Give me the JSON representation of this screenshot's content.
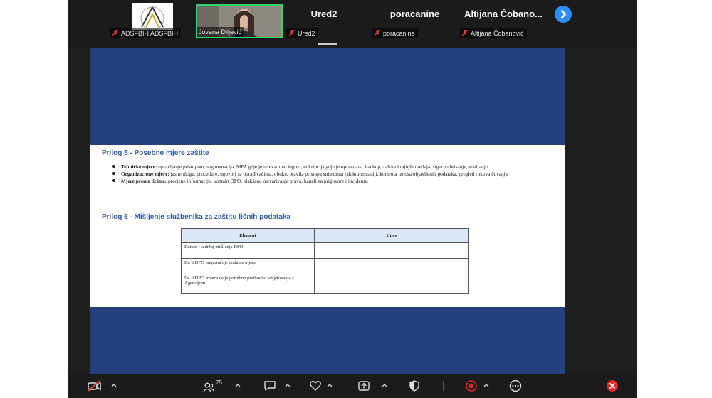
{
  "participants": [
    {
      "label": "ADSFBIH ADSFBIH",
      "kind": "avatar"
    },
    {
      "label": "Jovana Diljević",
      "kind": "video"
    },
    {
      "label": "Ured2",
      "display_name": "Ured2",
      "kind": "name"
    },
    {
      "label": "poracanine",
      "display_name": "poracanine",
      "kind": "name"
    },
    {
      "label": "Altijana Čobanović",
      "display_name": "Altijana Čobano...",
      "kind": "name"
    }
  ],
  "document": {
    "section5_title": "Prilog 5 - Posebne mjere zaštite",
    "bullets": [
      {
        "term": "Tehničke mjere:",
        "text": " upravljanje pristupom, segmentacija, MFA gdje je relevantna, logovi, enkripcija gdje je opravdana, backup, zaštita krajnjih uređaja, sigurno brisanje, testiranje."
      },
      {
        "term": "Organizacione mjere:",
        "text": " jasne uloge, procedure, ugovori sa obrađivačima, obuke, pravila pristupa snimcima i dokumentaciji, kontrola iznosa objavljenih podataka, pregled rokova čuvanja."
      },
      {
        "term": "Mjere prema licima:",
        "text": " precizne informacije, kontakt DPO, olakšano ostvarivanje prava, kanali za prigovore i incidente."
      }
    ],
    "section6_title": "Prilog 6 - Mišljenje službenika za zaštitu ličnih podataka",
    "table": {
      "headers": [
        "Element",
        "Unos"
      ],
      "rows": [
        [
          "Datum i sadržaj mišljenja DPO",
          ""
        ],
        [
          "Da li DPO preporučuje dodatne mjere",
          ""
        ],
        [
          "Da li DPO smatra da je potrebno prethodno savjetovanje s Agencijom",
          ""
        ]
      ]
    }
  },
  "toolbar": {
    "participant_count": "75"
  },
  "colors": {
    "accent_blue": "#2d8cff",
    "active_speaker_border": "#2fd36b",
    "share_background": "#24407e",
    "record_red": "#e02828",
    "heading_blue": "#2f5d9e"
  }
}
